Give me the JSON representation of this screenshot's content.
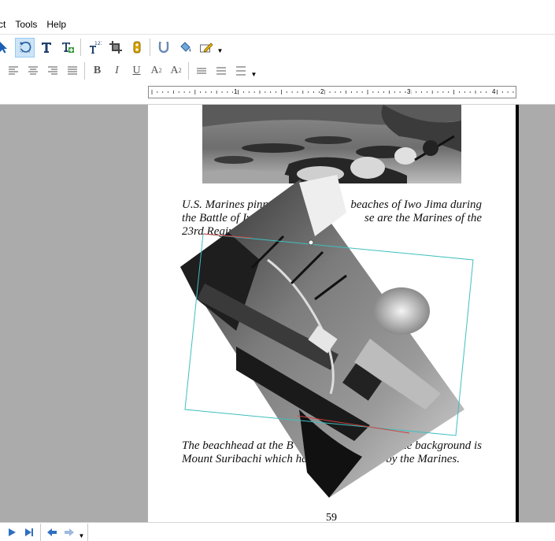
{
  "menu": {
    "items": [
      "ct",
      "Tools",
      "Help"
    ]
  },
  "toolbar_main": {
    "buttons": [
      {
        "name": "select-pointer-icon"
      },
      {
        "name": "rotate-tool-icon",
        "active": true
      },
      {
        "name": "text-tool-icon"
      },
      {
        "name": "insert-text-box-icon"
      },
      {
        "name": "superscript-tool-icon"
      },
      {
        "name": "crop-tool-icon"
      },
      {
        "name": "link-tool-icon"
      },
      {
        "name": "magnet-tool-icon"
      },
      {
        "name": "fill-bucket-icon"
      },
      {
        "name": "pencil-tool-icon"
      }
    ]
  },
  "toolbar_format": {
    "align_buttons": [
      "align-left-icon",
      "align-center-icon",
      "align-right-icon",
      "justify-icon"
    ],
    "bold": "B",
    "italic": "I",
    "underline": "U",
    "superscript": "A",
    "superscript_mark": "2",
    "subscript": "A",
    "subscript_mark": "2"
  },
  "ruler": {
    "labels": [
      "1",
      "2",
      "3",
      "4"
    ]
  },
  "document": {
    "caption_top": "U.S. Marines pinned down on the beaches of Iwo Jima during the Battle of Iwo Jima. These are the Marines of the 23rd Regiment.",
    "caption_top_visible": "U.S. Marines pinned",
    "caption_top_line1_end": "beaches of Iwo Jima during",
    "caption_top_line2_start": "the Battle of Iw",
    "caption_top_line2_end": "se are the Marines of the",
    "caption_top_line3": "23rd Regim",
    "caption_bottom_line1_start": "The beachhead at the B",
    "caption_bottom_line1_end": "the background is",
    "caption_bottom_line2_start": "Mount Suribachi which ha",
    "caption_bottom_line2_end": "by the Marines.",
    "page_number": "59"
  },
  "colors": {
    "selection_frame": "#3fbfbf",
    "rotation_frame": "#d04040",
    "active_tool_bg": "#cce4f7",
    "workspace_bg": "#ababab"
  }
}
